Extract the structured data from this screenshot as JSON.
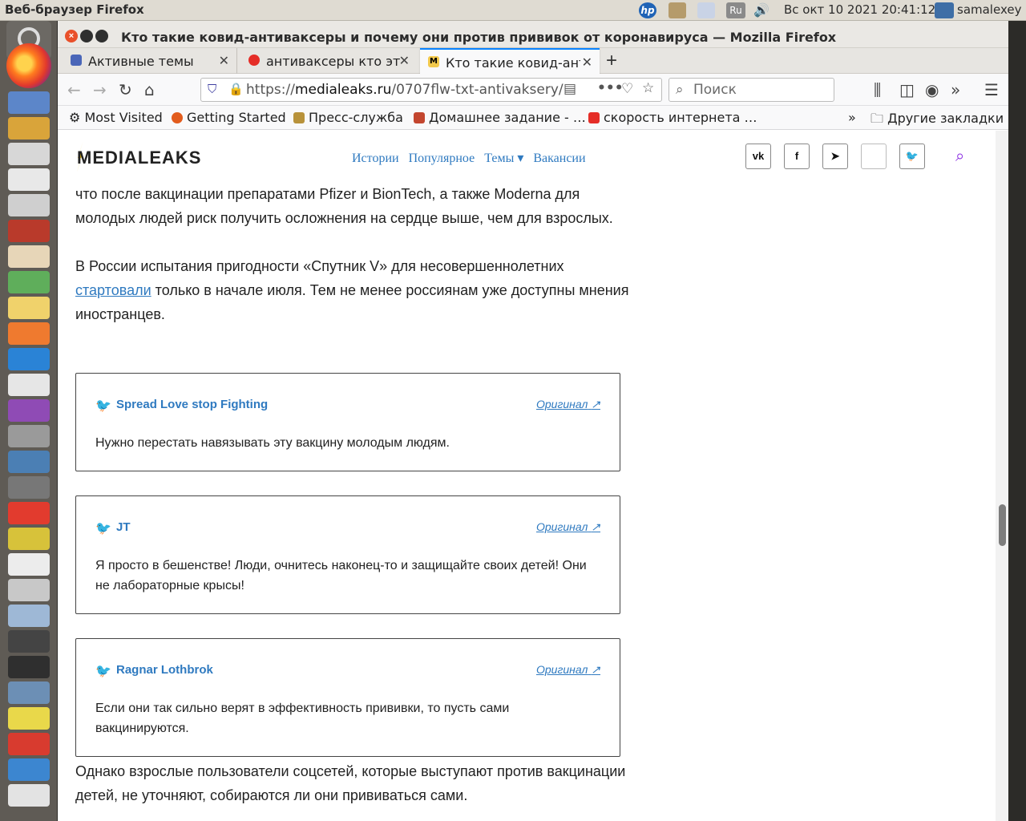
{
  "system_panel": {
    "app_name": "Веб-браузер Firefox",
    "hp_label": "hp",
    "lang": "Ru",
    "clock": "Вс окт 10 2021 20:41:12",
    "user": "samalexey"
  },
  "window": {
    "title": "Кто такие ковид-антиваксеры и почему они против прививок от коронавируса — Mozilla Firefox"
  },
  "tabs": [
    {
      "label": "Активные темы",
      "close": "✕"
    },
    {
      "label": "антиваксеры кто это",
      "close": "✕"
    },
    {
      "label": "Кто такие ковид-антиваксеры",
      "close": "✕",
      "favicon": "M"
    }
  ],
  "tab_new": "+",
  "navbar": {
    "url_host": "medialeaks.ru",
    "url_prefix": "https://",
    "url_path": "/0707flw-txt-antivaksery/",
    "search_placeholder": "Поиск"
  },
  "bookmarks": [
    {
      "label": "Most Visited",
      "color": "#555555"
    },
    {
      "label": "Getting Started",
      "color": "#e25c1d"
    },
    {
      "label": "Пресс-служба",
      "color": "#b8923a"
    },
    {
      "label": "Домашнее задание - …",
      "color": "#c3462f"
    },
    {
      "label": "скорость интернета …",
      "color": "#e52d27"
    }
  ],
  "bookmarks_other": "Другие закладки",
  "site": {
    "logo": "MEDIALEAKS",
    "nav": [
      "Истории",
      "Популярное",
      "Темы ▾",
      "Вакансии"
    ],
    "social": {
      "vk": "vk",
      "fb": "f",
      "tg": "➤",
      "tw": "🐦"
    }
  },
  "article": {
    "para1": "что после вакцинации препаратами Pfizer и BionTech, а также Moderna для молодых людей риск получить осложнения на сердце выше, чем для взрослых.",
    "para2_before": "В России испытания пригодности «Спутник V» для несовершеннолетних ",
    "para2_link": "стартовали",
    "para2_after": " только в начале июля. Тем не менее россиянам уже доступны мнения иностранцев.",
    "para3": "Однако взрослые пользователи соцсетей, которые выступают против вакцинации детей, не уточняют, собираются ли они прививаться сами."
  },
  "tweets": [
    {
      "author": "Spread Love stop Fighting",
      "original": "Оригинал",
      "text": "Нужно перестать навязывать эту вакцину молодым людям."
    },
    {
      "author": "JT",
      "original": "Оригинал",
      "text": "Я просто в бешенстве! Люди, очнитесь наконец-то и защищайте своих детей! Они не лабораторные крысы!"
    },
    {
      "author": "Ragnar Lothbrok",
      "original": "Оригинал",
      "text": "Если они так сильно верят в эффективность прививки, то пусть сами вакцинируются."
    }
  ],
  "colors": {
    "accent": "#0a84ff",
    "link": "#2f7ac0",
    "twitter": "#1da1f2",
    "close": "#e9502a"
  }
}
